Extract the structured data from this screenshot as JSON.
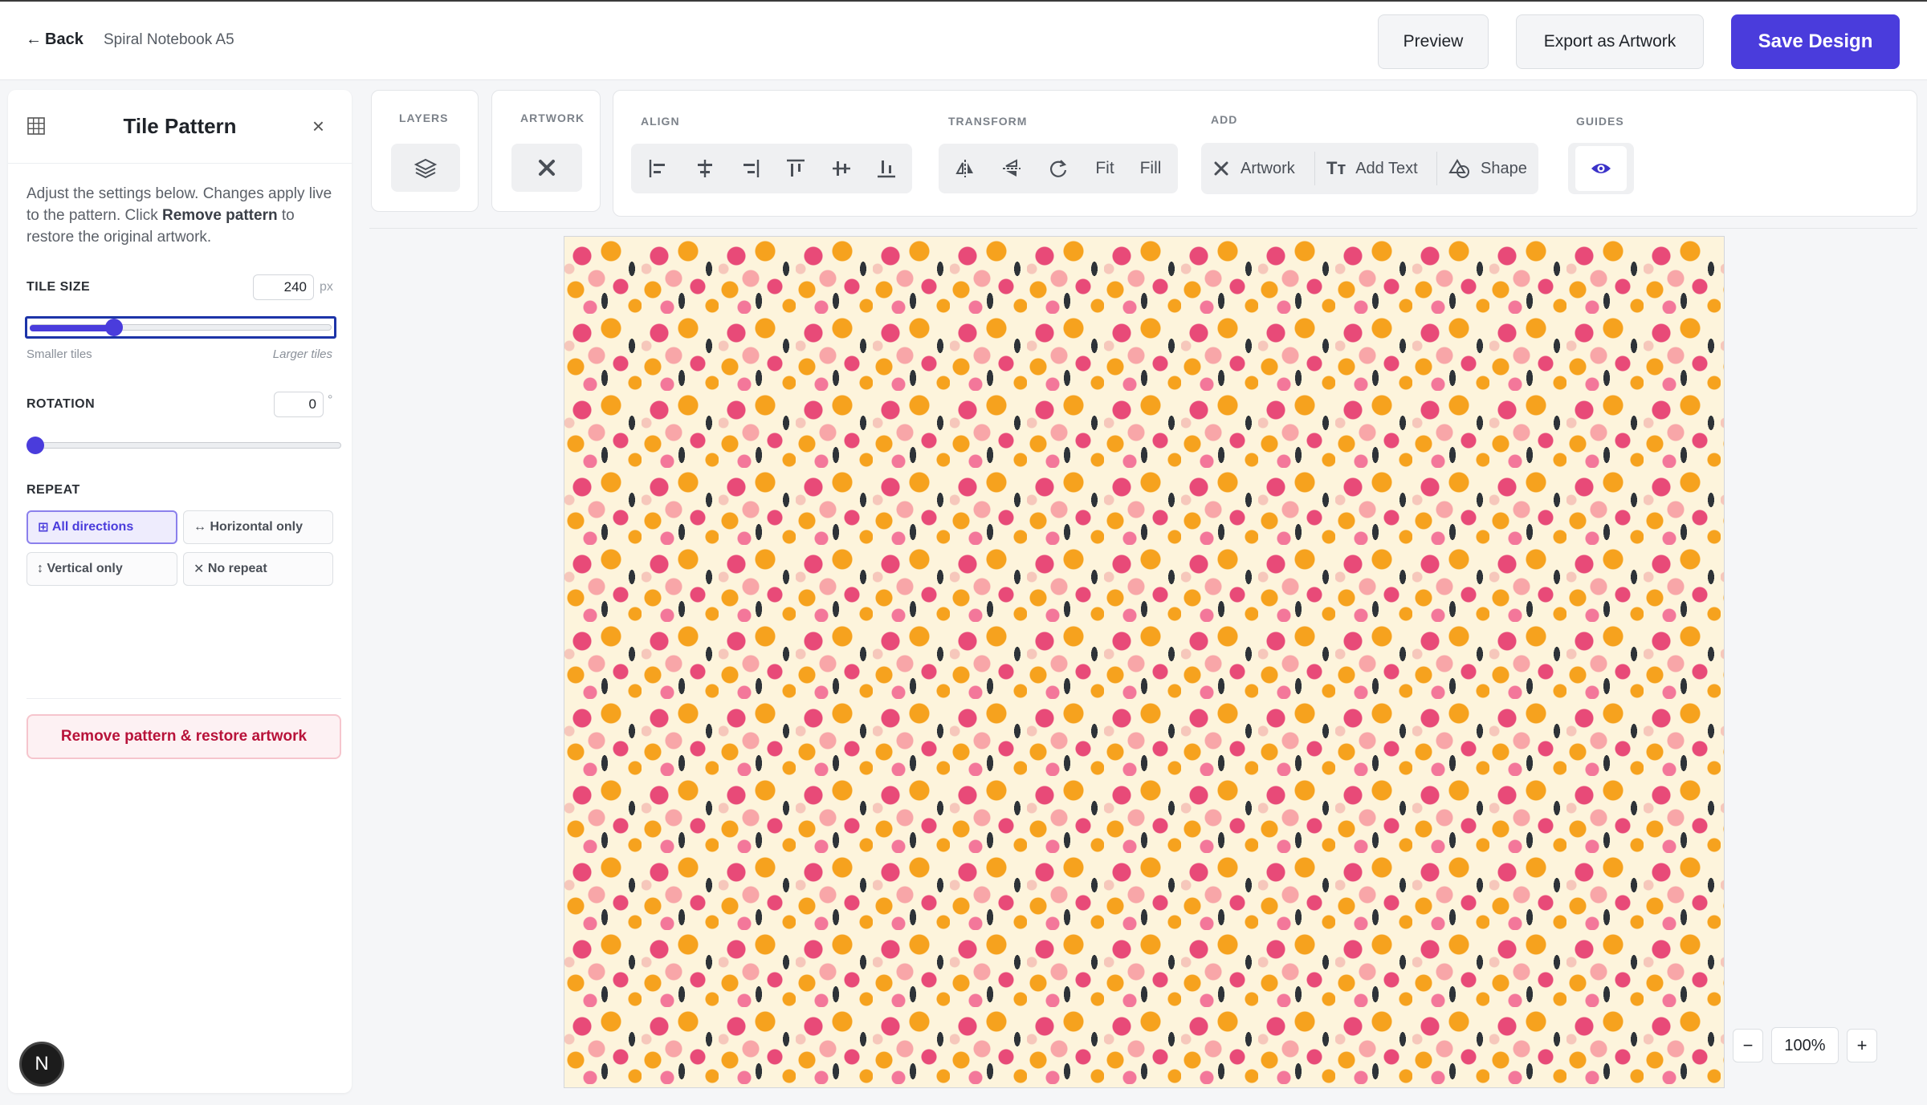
{
  "header": {
    "back_label": "Back",
    "document_name": "Spiral Notebook A5",
    "preview_label": "Preview",
    "export_label": "Export as Artwork",
    "save_label": "Save Design"
  },
  "panel": {
    "title": "Tile Pattern",
    "description_start": "Adjust the settings below. Changes apply live to the pattern. Click ",
    "description_bold": "Remove pattern",
    "description_end": " to restore the original artwork.",
    "tile_size": {
      "label": "TILE SIZE",
      "value": "240",
      "unit": "px",
      "fraction": 0.28,
      "min_hint": "Smaller tiles",
      "max_hint": "Larger tiles"
    },
    "rotation": {
      "label": "ROTATION",
      "value": "0",
      "unit": "°",
      "fraction": 0
    },
    "repeat": {
      "label": "REPEAT",
      "options": [
        {
          "icon": "⊞",
          "label": "All directions",
          "active": true
        },
        {
          "icon": "↔",
          "label": "Horizontal only",
          "active": false
        },
        {
          "icon": "↕",
          "label": "Vertical only",
          "active": false
        },
        {
          "icon": "✕",
          "label": "No repeat",
          "active": false
        }
      ]
    },
    "remove_label": "Remove pattern & restore artwork",
    "avatar_letter": "N"
  },
  "toolbar": {
    "layers_label": "LAYERS",
    "artwork_label": "ARTWORK",
    "align_label": "ALIGN",
    "transform_label": "TRANSFORM",
    "fit_label": "Fit",
    "fill_label": "Fill",
    "add_label": "ADD",
    "add_artwork_label": "Artwork",
    "add_text_label": "Add Text",
    "add_shape_label": "Shape",
    "guides_label": "GUIDES"
  },
  "zoom": {
    "minus": "−",
    "value": "100%",
    "plus": "+"
  },
  "colors": {
    "accent": "#4a3cdc",
    "danger": "#b8133a",
    "pattern_background": "#fdf4dc",
    "pattern_pink": "#e84a78",
    "pattern_orange": "#f6a21e",
    "pattern_leaf": "#2e3338"
  }
}
